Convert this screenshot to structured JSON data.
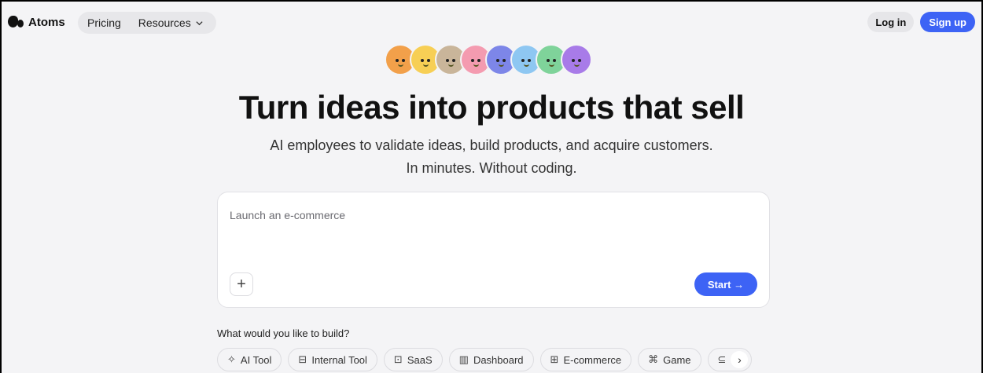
{
  "header": {
    "brand": "Atoms",
    "nav": [
      {
        "label": "Pricing"
      },
      {
        "label": "Resources"
      }
    ],
    "login": "Log in",
    "signup": "Sign up"
  },
  "avatars": [
    {
      "color": "#f2a04a"
    },
    {
      "color": "#f7cf55"
    },
    {
      "color": "#c9b59a"
    },
    {
      "color": "#f49bb0"
    },
    {
      "color": "#7d86e8"
    },
    {
      "color": "#8ec7f2"
    },
    {
      "color": "#7fd39a"
    },
    {
      "color": "#a87be8"
    }
  ],
  "hero": {
    "headline": "Turn ideas into products that sell",
    "sub_line1": "AI employees to validate ideas, build products, and acquire customers.",
    "sub_line2": "In minutes. Without coding."
  },
  "prompt": {
    "placeholder": "Launch an e-commerce",
    "plus": "+",
    "start": "Start →"
  },
  "suggestions": {
    "question": "What would you like to build?",
    "chips": [
      {
        "label": "AI Tool",
        "icon": "sparkle-icon",
        "glyph": "✧"
      },
      {
        "label": "Internal Tool",
        "icon": "briefcase-icon",
        "glyph": "⊟"
      },
      {
        "label": "SaaS",
        "icon": "window-icon",
        "glyph": "⊡"
      },
      {
        "label": "Dashboard",
        "icon": "chart-icon",
        "glyph": "▥"
      },
      {
        "label": "E-commerce",
        "icon": "store-icon",
        "glyph": "⊞"
      },
      {
        "label": "Game",
        "icon": "gamepad-icon",
        "glyph": "⌘"
      }
    ],
    "more_glyph": "⊆",
    "next_glyph": "›"
  },
  "colors": {
    "accent": "#3d63f5",
    "background": "#f4f4f6"
  }
}
